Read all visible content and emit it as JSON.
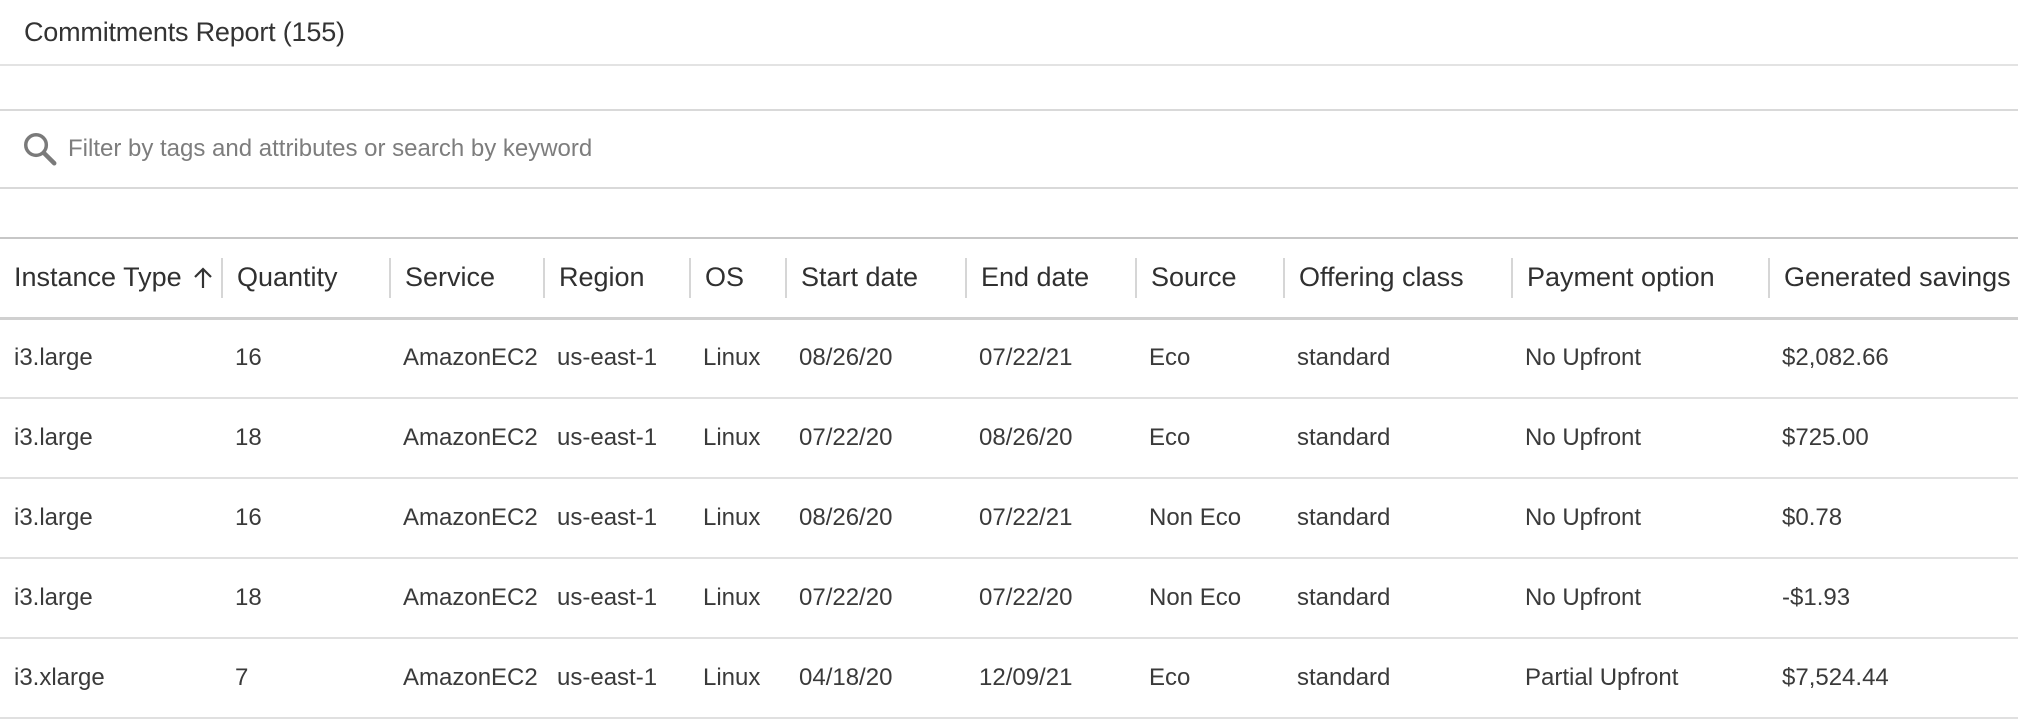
{
  "header": {
    "title": "Commitments Report (155)"
  },
  "search": {
    "placeholder": "Filter by tags and attributes or search by keyword",
    "value": ""
  },
  "table": {
    "columns": [
      {
        "label": "Instance Type",
        "sort": "ascending"
      },
      {
        "label": "Quantity"
      },
      {
        "label": "Service"
      },
      {
        "label": "Region"
      },
      {
        "label": "OS"
      },
      {
        "label": "Start date"
      },
      {
        "label": "End date"
      },
      {
        "label": "Source"
      },
      {
        "label": "Offering class"
      },
      {
        "label": "Payment option"
      },
      {
        "label": "Generated savings"
      }
    ],
    "rows": [
      [
        "i3.large",
        "16",
        "AmazonEC2",
        "us-east-1",
        "Linux",
        "08/26/20",
        "07/22/21",
        "Eco",
        "standard",
        "No Upfront",
        "$2,082.66"
      ],
      [
        "i3.large",
        "18",
        "AmazonEC2",
        "us-east-1",
        "Linux",
        "07/22/20",
        "08/26/20",
        "Eco",
        "standard",
        "No Upfront",
        "$725.00"
      ],
      [
        "i3.large",
        "16",
        "AmazonEC2",
        "us-east-1",
        "Linux",
        "08/26/20",
        "07/22/21",
        "Non Eco",
        "standard",
        "No Upfront",
        "$0.78"
      ],
      [
        "i3.large",
        "18",
        "AmazonEC2",
        "us-east-1",
        "Linux",
        "07/22/20",
        "07/22/20",
        "Non Eco",
        "standard",
        "No Upfront",
        "-$1.93"
      ],
      [
        "i3.xlarge",
        "7",
        "AmazonEC2",
        "us-east-1",
        "Linux",
        "04/18/20",
        "12/09/21",
        "Eco",
        "standard",
        "Partial Upfront",
        "$7,524.44"
      ]
    ]
  },
  "icons": {
    "search": "search-icon",
    "sort": "arrow-up-icon"
  },
  "colors": {
    "text": "#333333",
    "placeholder": "#7d7d7d",
    "border": "#d9d9d9"
  }
}
